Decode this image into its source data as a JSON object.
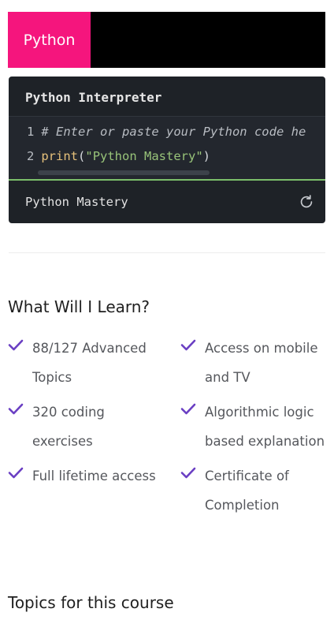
{
  "tabs": [
    {
      "label": "Python",
      "active": true
    }
  ],
  "interpreter": {
    "title": "Python Interpreter",
    "code_lines": [
      {
        "num": "1",
        "comment": "# Enter or paste your Python code he"
      },
      {
        "num": "2",
        "fn": "print",
        "open": "(",
        "str": "\"Python Mastery\"",
        "close": ")"
      }
    ],
    "output": "Python Mastery",
    "refresh_icon": "refresh-icon"
  },
  "learn": {
    "heading": "What Will I Learn?",
    "left_items": [
      "88/127 Advanced Topics",
      "320 coding exercises",
      "Full lifetime access"
    ],
    "right_items": [
      "Access on mobile and TV",
      "Algorithmic logic based explanation",
      "Certificate of Completion"
    ],
    "check_icon": "check-icon"
  },
  "topics": {
    "heading": "Topics for this course"
  },
  "colors": {
    "accent_tab": "#f5157d",
    "check": "#6a3fc3",
    "editor_bg": "#1e2227",
    "output_border": "#7bbf6a"
  }
}
